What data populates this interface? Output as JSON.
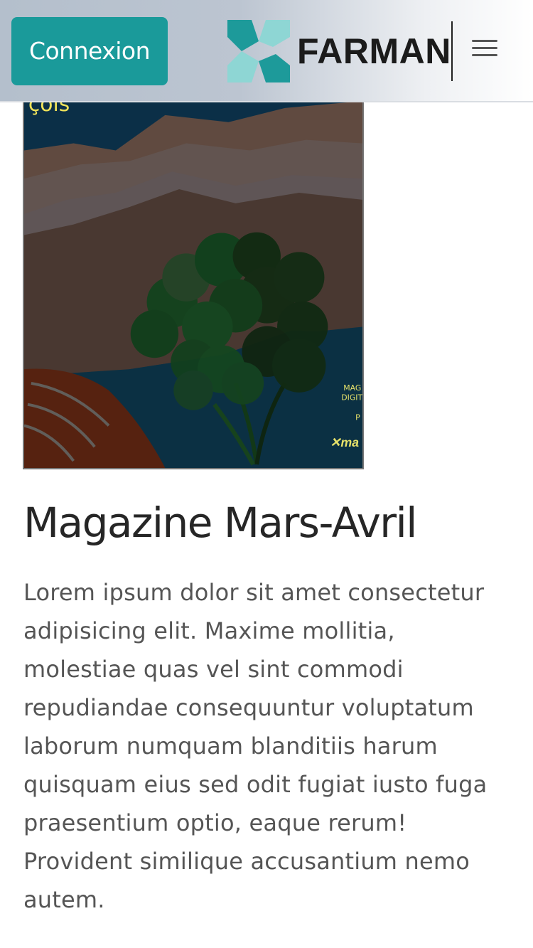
{
  "header": {
    "login_label": "Connexion",
    "logo_text": "FARMAN",
    "logo_icon": "farman-x-logo",
    "menu_icon": "hamburger-menu-icon",
    "accent_color": "#1a9a9a"
  },
  "cover": {
    "image_icon": "magazine-cover-illustration",
    "top_fragment": "çois",
    "side_text_lines": [
      "MAG",
      "DIGIT",
      "P"
    ],
    "brand_fragment": "ma"
  },
  "article": {
    "title": "Magazine Mars-Avril",
    "body": "Lorem ipsum dolor sit amet consectetur adipisicing elit. Maxime mollitia, molestiae quas vel sint commodi repudiandae consequuntur voluptatum laborum numquam blanditiis harum quisquam eius sed odit fugiat iusto fuga praesentium optio, eaque rerum! Provident similique accusantium nemo autem."
  }
}
